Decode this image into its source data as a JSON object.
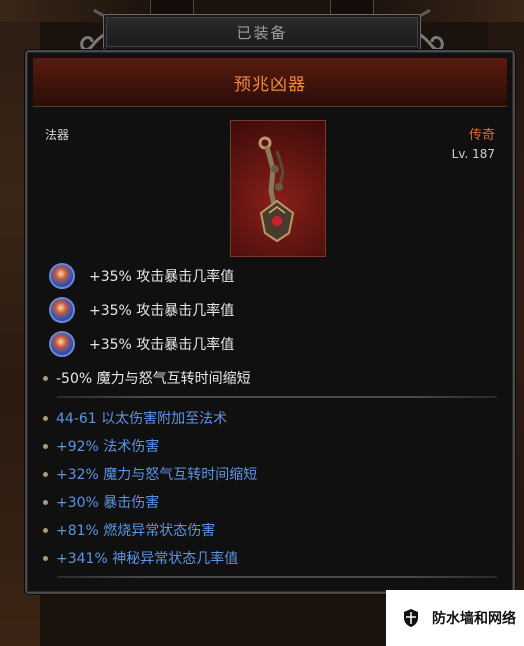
{
  "header": {
    "title": "已装备"
  },
  "item": {
    "name": "预兆凶器",
    "type": "法器",
    "rarity": "传奇",
    "level": "Lv. 187",
    "rarity_color": "#e06a2a",
    "name_color": "#f08a3a"
  },
  "gem_affixes": [
    {
      "icon": "gem-socket-icon",
      "text": "+35% 攻击暴击几率值"
    },
    {
      "icon": "gem-socket-icon",
      "text": "+35% 攻击暴击几率值"
    },
    {
      "icon": "gem-socket-icon",
      "text": "+35% 攻击暴击几率值"
    }
  ],
  "base_affix": {
    "text": "-50% 魔力与怒气互转时间缩短"
  },
  "magic_affixes": [
    {
      "text": "44-61 以太伤害附加至法术"
    },
    {
      "text": "+92% 法术伤害"
    },
    {
      "text": "+32% 魔力与怒气互转时间缩短"
    },
    {
      "text": "+30% 暴击伤害"
    },
    {
      "text": "+81% 燃烧异常状态伤害"
    },
    {
      "text": "+341% 神秘异常状态几率值"
    }
  ],
  "affix_color": "#5c94e6",
  "watermark": {
    "icon": "shield-icon",
    "text": "防水墙和网络"
  }
}
